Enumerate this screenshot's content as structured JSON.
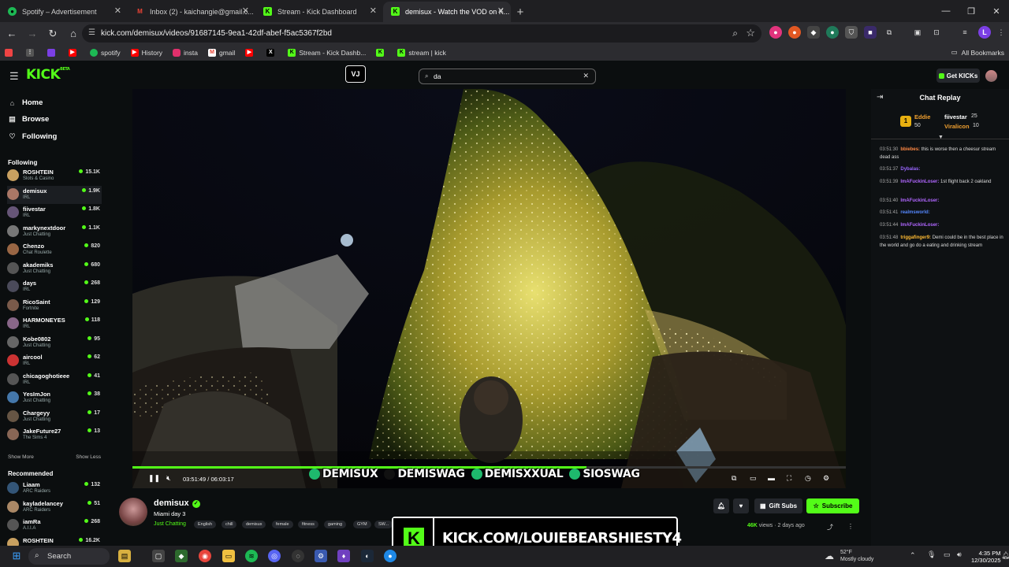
{
  "browser": {
    "tabs": [
      {
        "label": "Spotify – Advertisement",
        "color": "#1db954",
        "glyph": "●"
      },
      {
        "label": "Inbox (2) - kaichangie@gmail.c...",
        "color": "#ea4335",
        "glyph": "M"
      },
      {
        "label": "Stream - Kick Dashboard",
        "color": "#53fc18",
        "glyph": "K"
      },
      {
        "label": "demisux - Watch the VOD on K...",
        "color": "#53fc18",
        "glyph": "K"
      }
    ],
    "url": "kick.com/demisux/videos/91687145-9ea1-42df-abef-f5ac5367f2bd",
    "bookmarks": [
      {
        "label": "",
        "color": "#7b3fe4"
      },
      {
        "label": "",
        "color": "#ff0000"
      },
      {
        "label": "spotify",
        "color": "#1db954"
      },
      {
        "label": "History",
        "color": "#ff0000"
      },
      {
        "label": "insta",
        "color": "#e1306c"
      },
      {
        "label": "gmail",
        "color": "#ea4335"
      },
      {
        "label": "",
        "color": "#ff0000"
      },
      {
        "label": "",
        "color": "#333333"
      },
      {
        "label": "Stream - Kick Dashb...",
        "color": "#53fc18"
      },
      {
        "label": "",
        "color": "#53fc18"
      },
      {
        "label": "stream | kick",
        "color": "#53fc18"
      }
    ],
    "all_bookmarks": "All Bookmarks",
    "profile_initial": "L"
  },
  "kick": {
    "logo": "KICK",
    "logo_sup": "BETA",
    "search_value": "da",
    "get_kicks": "Get KICKs",
    "vj_label": "VJ"
  },
  "sidebar": {
    "nav": [
      {
        "label": "Home",
        "icon": "home-icon"
      },
      {
        "label": "Browse",
        "icon": "browse-icon"
      },
      {
        "label": "Following",
        "icon": "heart-icon"
      }
    ],
    "following_header": "Following",
    "following": [
      {
        "name": "ROSHTEIN",
        "cat": "Slots & Casino",
        "viewers": "15.1K",
        "color": "#c8a060"
      },
      {
        "name": "demisux",
        "cat": "IRL",
        "viewers": "1.9K",
        "color": "#aa7766"
      },
      {
        "name": "fiivestar",
        "cat": "IRL",
        "viewers": "1.8K",
        "color": "#665577"
      },
      {
        "name": "markynextdoor",
        "cat": "Just Chatting",
        "viewers": "1.1K",
        "color": "#777777"
      },
      {
        "name": "Chenzo",
        "cat": "Chat Roulette",
        "viewers": "820",
        "color": "#996644"
      },
      {
        "name": "akademiks",
        "cat": "Just Chatting",
        "viewers": "680",
        "color": "#555555"
      },
      {
        "name": "days",
        "cat": "IRL",
        "viewers": "268",
        "color": "#4a4a5a"
      },
      {
        "name": "RicoSaint",
        "cat": "Fortnite",
        "viewers": "129",
        "color": "#7a5a4a"
      },
      {
        "name": "HARMONEYES",
        "cat": "IRL",
        "viewers": "118",
        "color": "#886688"
      },
      {
        "name": "Kobe0802",
        "cat": "Just Chatting",
        "viewers": "95",
        "color": "#666666"
      },
      {
        "name": "aircool",
        "cat": "IRL",
        "viewers": "62",
        "color": "#cc3333"
      },
      {
        "name": "chicagoghotieee",
        "cat": "IRL",
        "viewers": "41",
        "color": "#555555"
      },
      {
        "name": "YesImJon",
        "cat": "Just Chatting",
        "viewers": "38",
        "color": "#4477aa"
      },
      {
        "name": "Chargeyy",
        "cat": "Just Chatting",
        "viewers": "17",
        "color": "#665544"
      },
      {
        "name": "JakeFuture27",
        "cat": "The Sims 4",
        "viewers": "13",
        "color": "#886655"
      }
    ],
    "show_more": "Show More",
    "show_less": "Show Less",
    "recommended_header": "Recommended",
    "recommended": [
      {
        "name": "Liaam",
        "cat": "ARC Raiders",
        "viewers": "132",
        "color": "#335577"
      },
      {
        "name": "kayladelancey",
        "cat": "ARC Raiders",
        "viewers": "51",
        "color": "#aa8866"
      },
      {
        "name": "iamRa",
        "cat": "A.I.I.A",
        "viewers": "268",
        "color": "#555555"
      },
      {
        "name": "ROSHTEIN",
        "cat": "",
        "viewers": "16.2K",
        "color": "#c8a060"
      }
    ]
  },
  "player": {
    "time_current": "03:51:49",
    "time_total": "06:03:17",
    "progress_fraction": 0.637,
    "overlay_handles": [
      "DEMISUX",
      "DEMISWAG",
      "DEMISXXUAL",
      "SIOSWAG"
    ]
  },
  "stream": {
    "name": "demisux",
    "title": "Miami day 3",
    "category": "Just Chatting",
    "tags": [
      "English",
      "chill",
      "demisux",
      "female",
      "fitness",
      "gaming",
      "GYM",
      "SW..."
    ],
    "gift_subs": "Gift Subs",
    "subscribe": "Subscribe",
    "views": "46K",
    "views_suffix": "views",
    "ago": "2 days ago"
  },
  "banner_text": "KICK.COM/LOUIEBEARSHIESTY4",
  "chat": {
    "header": "Chat Replay",
    "leaders": [
      {
        "name": "Eddie",
        "amount": "50",
        "color": "#f0a030"
      },
      {
        "name": "fiivestar",
        "amount": "25",
        "color": "#ffffff"
      },
      {
        "name": "Viralicon",
        "amount": "10",
        "color": "#f0a030"
      }
    ],
    "messages": [
      {
        "time": "03:51:30",
        "user": "bbiebes:",
        "ucolor": "#ff8844",
        "text": "this is worse then a cheesur stream dead ass"
      },
      {
        "time": "03:51:37",
        "user": "Dybalas:",
        "ucolor": "#9a66ff",
        "text": ""
      },
      {
        "time": "03:51:39",
        "user": "ImAFuckinLoser:",
        "ucolor": "#b066ff",
        "text": "1st flight back 2 oakland"
      },
      {
        "time": "03:51:40",
        "user": "ImAFuckinLoser:",
        "ucolor": "#b066ff",
        "text": ""
      },
      {
        "time": "03:51:41",
        "user": "realmsworld:",
        "ucolor": "#5588ff",
        "text": ""
      },
      {
        "time": "03:51:44",
        "user": "ImAFuckinLoser:",
        "ucolor": "#b066ff",
        "text": ""
      },
      {
        "time": "03:51:48",
        "user": "triggafinger9:",
        "ucolor": "#ffbb33",
        "text": "Demi could be in the best place in the world and go do a eating and drinking stream"
      }
    ]
  },
  "taskbar": {
    "search": "Search",
    "temp": "52°F",
    "weather": "Mostly cloudy",
    "time": "4:35 PM",
    "date": "12/30/2025"
  }
}
